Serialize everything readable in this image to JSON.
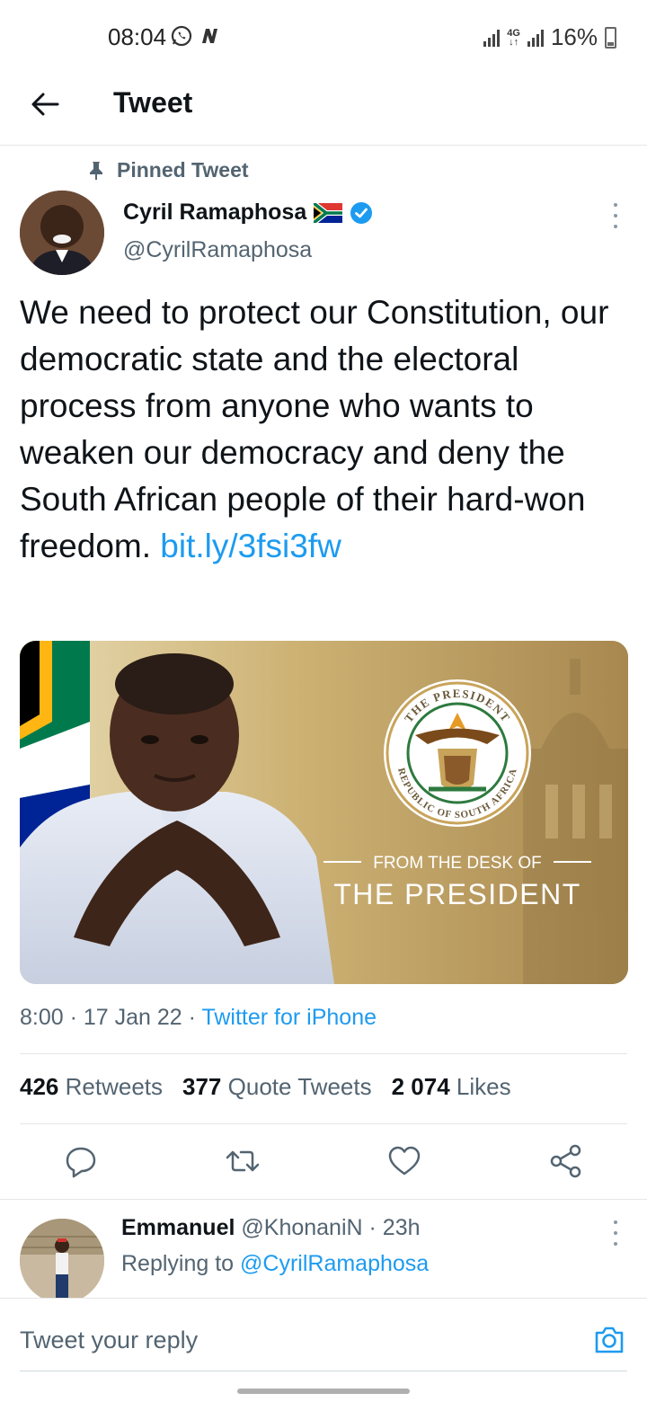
{
  "status_bar": {
    "time": "08:04",
    "battery": "16%"
  },
  "header": {
    "title": "Tweet"
  },
  "tweet": {
    "pinned_label": "Pinned Tweet",
    "author_name": "Cyril Ramaphosa",
    "author_handle": "@CyrilRamaphosa",
    "text": "We need to protect our Constitution, our democratic state and the electoral process from anyone who wants to weaken our democracy and deny the South African people of their hard-won freedom. ",
    "link": "bit.ly/3fsi3fw",
    "media": {
      "seal_top_text": "THE PRESIDENT",
      "seal_bottom_text": "REPUBLIC OF SOUTH AFRICA",
      "caption_small": "FROM THE DESK OF",
      "caption_large": "THE PRESIDENT"
    },
    "time": "8:00",
    "date": "17 Jan 22",
    "source": "Twitter for iPhone",
    "stats": {
      "retweets_count": "426",
      "retweets_label": "Retweets",
      "quotes_count": "377",
      "quotes_label": "Quote Tweets",
      "likes_count": "2 074",
      "likes_label": "Likes"
    },
    "actions": [
      "reply-icon",
      "retweet-icon",
      "like-icon",
      "share-icon"
    ]
  },
  "reply": {
    "name": "Emmanuel",
    "handle": "@KhonaniN",
    "age": "23h",
    "replying_to_label": "Replying to",
    "replying_to_handle": "@CyrilRamaphosa"
  },
  "composer": {
    "placeholder": "Tweet your reply"
  },
  "colors": {
    "accent": "#1d9bf0",
    "secondary_text": "#536471"
  }
}
